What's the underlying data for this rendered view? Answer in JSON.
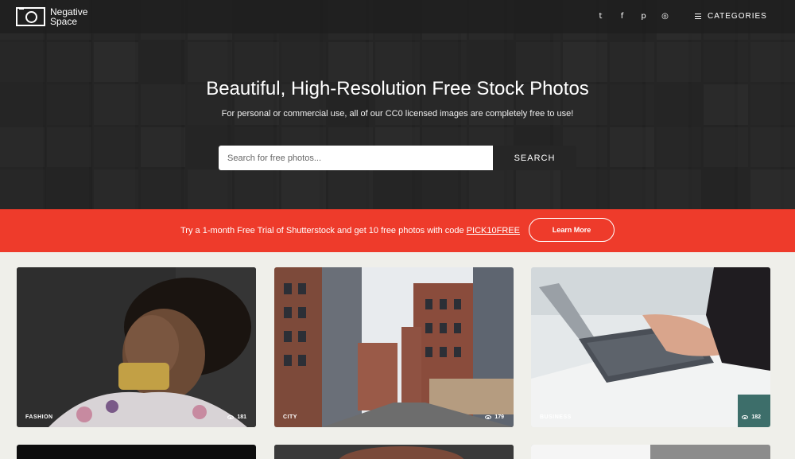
{
  "brand": {
    "line1": "Negative",
    "line2": "Space"
  },
  "nav": {
    "social": [
      {
        "icon": "twitter-icon",
        "glyph": "t"
      },
      {
        "icon": "facebook-icon",
        "glyph": "f"
      },
      {
        "icon": "pinterest-icon",
        "glyph": "p"
      },
      {
        "icon": "instagram-icon",
        "glyph": "◎"
      }
    ],
    "categories_label": "CATEGORIES"
  },
  "hero": {
    "title": "Beautiful, High-Resolution Free Stock Photos",
    "subtitle": "For personal or commercial use, all of our CC0 licensed images are completely free to use!",
    "search_placeholder": "Search for free photos...",
    "search_button": "SEARCH"
  },
  "promo": {
    "text": "Try a 1-month Free Trial of Shutterstock and get 10 free photos with code ",
    "code": "PICK10FREE",
    "button": "Learn More"
  },
  "photos": [
    {
      "category": "FASHION",
      "views": "181"
    },
    {
      "category": "CITY",
      "views": "179"
    },
    {
      "category": "BUSINESS",
      "views": "182"
    }
  ],
  "colors": {
    "promo_bg": "#ee3b2b",
    "search_btn": "#262626",
    "page_bg": "#efefea"
  }
}
